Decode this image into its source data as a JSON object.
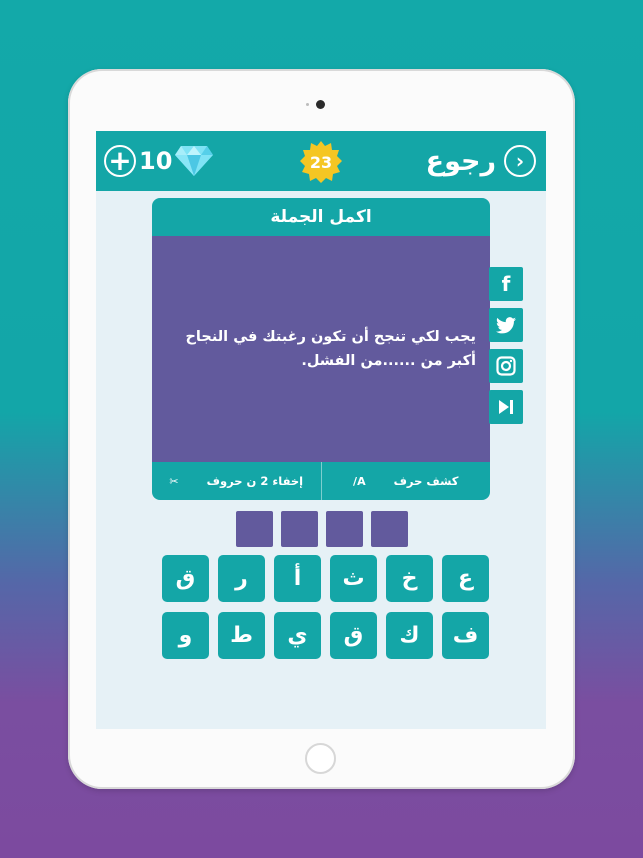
{
  "header": {
    "back_label": "رجوع",
    "back_icon": "chevron-right-icon",
    "level": "23",
    "coins": "10",
    "plus_label": "+"
  },
  "card": {
    "title": "اكمل الجملة",
    "question": "يجب لكي تنجح أن تكون رغبتك في النجاح أكبر من ......من الفشل.",
    "help": [
      {
        "label": "كشف حرف",
        "icon": "A/"
      },
      {
        "label": "إخفاء 2 ن حروف",
        "icon": "✂"
      }
    ]
  },
  "social": [
    "f",
    "twitter-icon",
    "instagram-icon",
    "skip-icon"
  ],
  "answer_slots": 4,
  "keys": [
    "ع",
    "خ",
    "ث",
    "أ",
    "ر",
    "ق",
    "ف",
    "ك",
    "ق",
    "ي",
    "ط",
    "و"
  ],
  "colors": {
    "teal": "#14a6a7",
    "purple": "#625a9d",
    "screen_bg": "#e6f1f6",
    "gold": "#f5c623"
  }
}
